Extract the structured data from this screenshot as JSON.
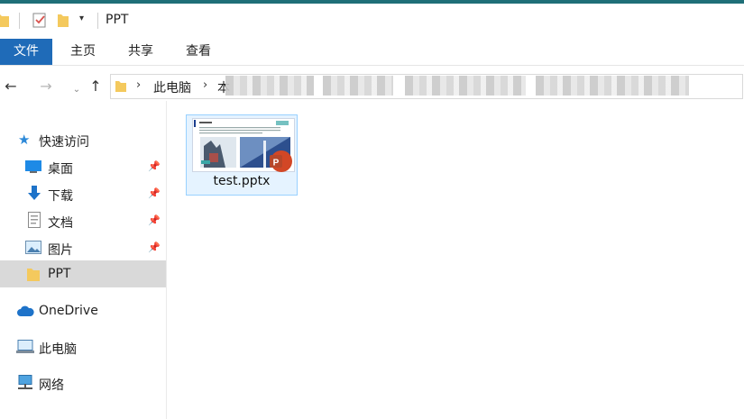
{
  "window": {
    "title": "PPT"
  },
  "ribbon": {
    "tabs": [
      "文件",
      "主页",
      "共享",
      "查看"
    ]
  },
  "address": {
    "segments": [
      "此电脑",
      "本"
    ]
  },
  "sidebar": {
    "quick_access_label": "快速访问",
    "items": [
      {
        "label": "桌面",
        "pinned": true
      },
      {
        "label": "下载",
        "pinned": true
      },
      {
        "label": "文档",
        "pinned": true
      },
      {
        "label": "图片",
        "pinned": true
      },
      {
        "label": "PPT",
        "pinned": false,
        "selected": true
      }
    ],
    "onedrive_label": "OneDrive",
    "this_pc_label": "此电脑",
    "network_label": "网络"
  },
  "files": [
    {
      "name": "test.pptx",
      "icon": "powerpoint-icon"
    }
  ],
  "colors": {
    "accent": "#1f6f78",
    "file_tab": "#1f6bb8",
    "selection": "#e5f3ff",
    "selection_border": "#99d1ff",
    "powerpoint": "#d24726",
    "folder": "#f4c95d"
  }
}
